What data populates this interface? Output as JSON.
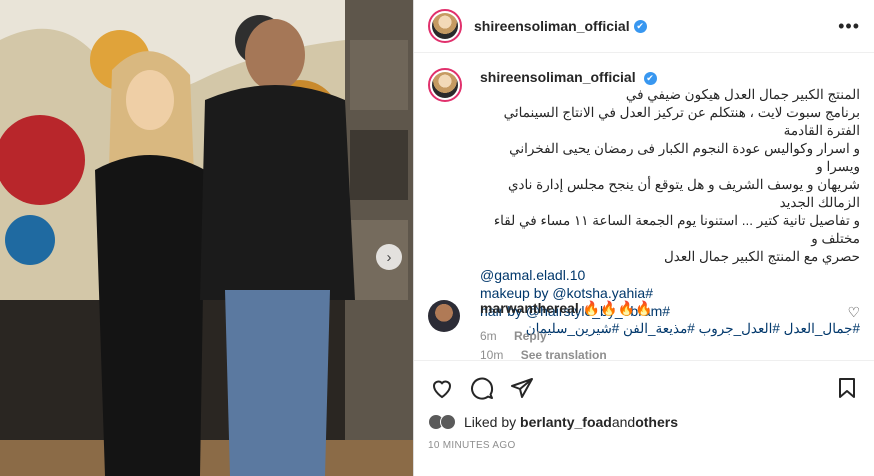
{
  "post": {
    "username": "shireensoliman_official",
    "verified_glyph": "✔",
    "more_glyph": "•••"
  },
  "caption": {
    "username": "shireensoliman_official",
    "lines": [
      "المنتج الكبير جمال العدل هيكون ضيفي في",
      "برنامج سبوت لايت ، هنتكلم عن تركيز العدل في الانتاج السينمائي الفترة القادمة",
      "و اسرار وكواليس عودة النجوم الكبار فى رمضان يحيى الفخراني ويسرا و",
      "شريهان و يوسف الشريف و هل يتوقع أن ينجح مجلس إدارة نادي الزمالك الجديد",
      "و تفاصيل تانية كتير ... استنونا يوم الجمعة الساعة ١١ مساء في لقاء مختلف و",
      "حصري مع المنتج الكبير جمال العدل"
    ],
    "mention": "@gamal.eladl.10",
    "makeup_label": "makeup by",
    "makeup_handle": "@kotsha.yahia#",
    "hair_label": "hair by",
    "hair_handle": "@hairstyle_by_ebram#",
    "hashtags": "#جمال_العدل #العدل_جروب #مذيعة_الفن #شيرين_سليمان",
    "time": "10m",
    "see_translation": "See translation"
  },
  "comment": {
    "username": "marwanthereal",
    "text": "🔥🔥🔥🔥",
    "time": "6m",
    "reply": "Reply"
  },
  "likes": {
    "prefix": "Liked by",
    "user": "berlanty_foad",
    "and": "and",
    "others": "others"
  },
  "timestamp": "10 MINUTES AGO",
  "icons": [
    "heart-icon",
    "comment-icon",
    "share-icon",
    "bookmark-icon",
    "next-arrow-icon"
  ]
}
